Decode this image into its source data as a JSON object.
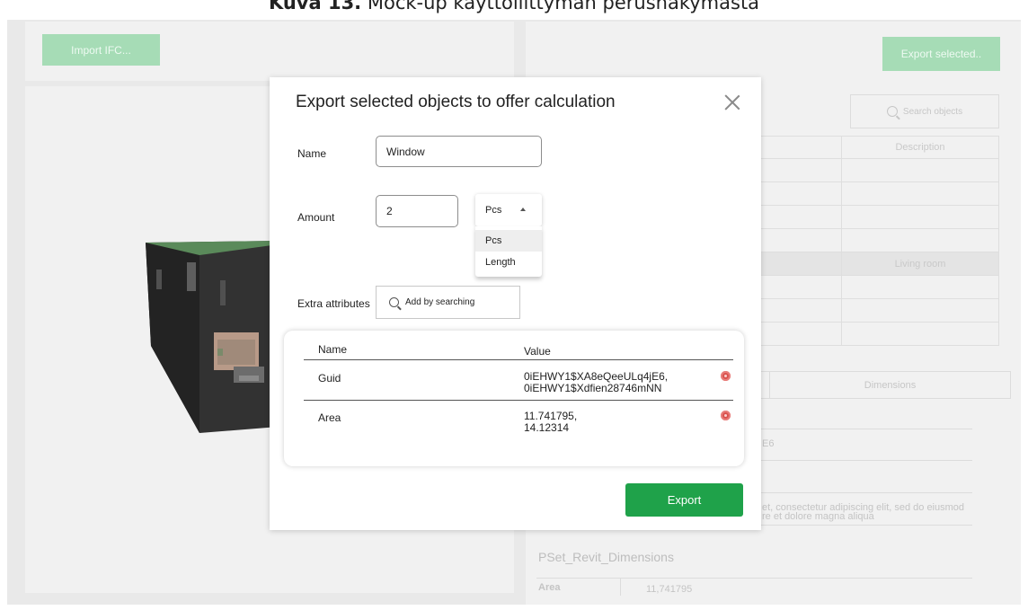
{
  "caption": {
    "label": "Kuva 13.",
    "text": " Mock-up käyttöliittymän perusnäkymästä"
  },
  "left": {
    "import_button": "Import IFC..."
  },
  "right": {
    "export_button": "Export selected..",
    "search_placeholder": "Search objects",
    "table": {
      "header": "Description",
      "rows": [
        "",
        "",
        "",
        "",
        "Living room",
        "",
        "",
        ""
      ]
    },
    "tabs": {
      "dimensions": "Dimensions"
    },
    "fragments": {
      "guid_tail": "E6",
      "lorem_line1": "et, consectetur adipiscing elit, sed do eiusmod",
      "lorem_line2": "re et dolore magna aliqua"
    },
    "pset": {
      "title": "PSet_Revit_Dimensions",
      "area_label": "Area",
      "area_value": "11,741795"
    }
  },
  "modal": {
    "title": "Export selected objects to offer calculation",
    "name_label": "Name",
    "name_value": "Window",
    "amount_label": "Amount",
    "amount_value": "2",
    "unit": {
      "selected": "Pcs",
      "options": [
        "Pcs",
        "Length"
      ]
    },
    "extra_label": "Extra attributes",
    "extra_search_placeholder": "Add by searching",
    "attributes": {
      "headers": [
        "Name",
        "Value"
      ],
      "rows": [
        {
          "name": "Guid",
          "value_line1": "0iEHWY1$XA8eQeeULq4jE6,",
          "value_line2": "0iEHWY1$Xdfien28746mNN"
        },
        {
          "name": "Area",
          "value_line1": "11.741795,",
          "value_line2": "14.12314"
        }
      ]
    },
    "export_button": "Export"
  },
  "colors": {
    "accent": "#1fa24a",
    "accent_faded": "#a6dcb6",
    "delete": "#d9534f"
  }
}
